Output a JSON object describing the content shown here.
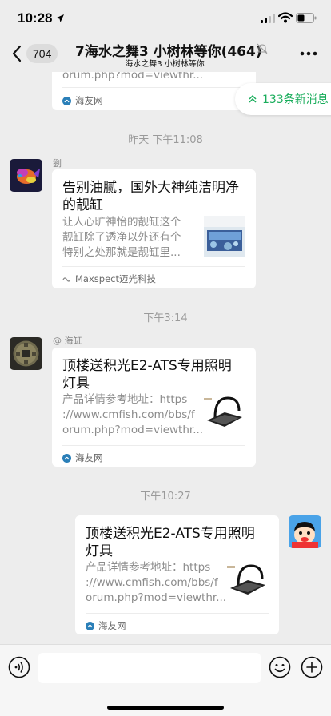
{
  "status_bar": {
    "time": "10:28"
  },
  "nav": {
    "unread_count": "704",
    "title": "7海水之舞3 小树林等你(464)",
    "subtitle": "海水之舞3 小树林等你"
  },
  "new_messages": {
    "label": "133条新消息"
  },
  "top_card": {
    "desc_tail": "orum.php?mod=viewthr...",
    "source": "海友网"
  },
  "separators": [
    "昨天 下午11:08",
    "下午3:14",
    "下午10:27"
  ],
  "messages": [
    {
      "sender": "劉",
      "title_line1": "告别油腻，国外大神纯洁明净",
      "title_line2": "的靓缸",
      "desc_line1": "让人心旷神怡的靓缸这个",
      "desc_line2": "靓缸除了透净以外还有个",
      "desc_line3": "特别之处那就是靓缸里...",
      "source": "Maxspect迈光科技"
    },
    {
      "sender": "@ 海缸",
      "title_line1": "顶楼送积光E2-ATS专用照明",
      "title_line2": "灯具",
      "desc_line1": "产品详情参考地址：https",
      "desc_line2": "://www.cmfish.com/bbs/f",
      "desc_line3": "orum.php?mod=viewthr...",
      "source": "海友网"
    },
    {
      "sender": "",
      "title_line1": "顶楼送积光E2-ATS专用照明",
      "title_line2": "灯具",
      "desc_line1": "产品详情参考地址：https",
      "desc_line2": "://www.cmfish.com/bbs/f",
      "desc_line3": "orum.php?mod=viewthr...",
      "source": "海友网"
    }
  ],
  "colors": {
    "accent_green": "#1aad5c",
    "bg": "#ededed"
  }
}
